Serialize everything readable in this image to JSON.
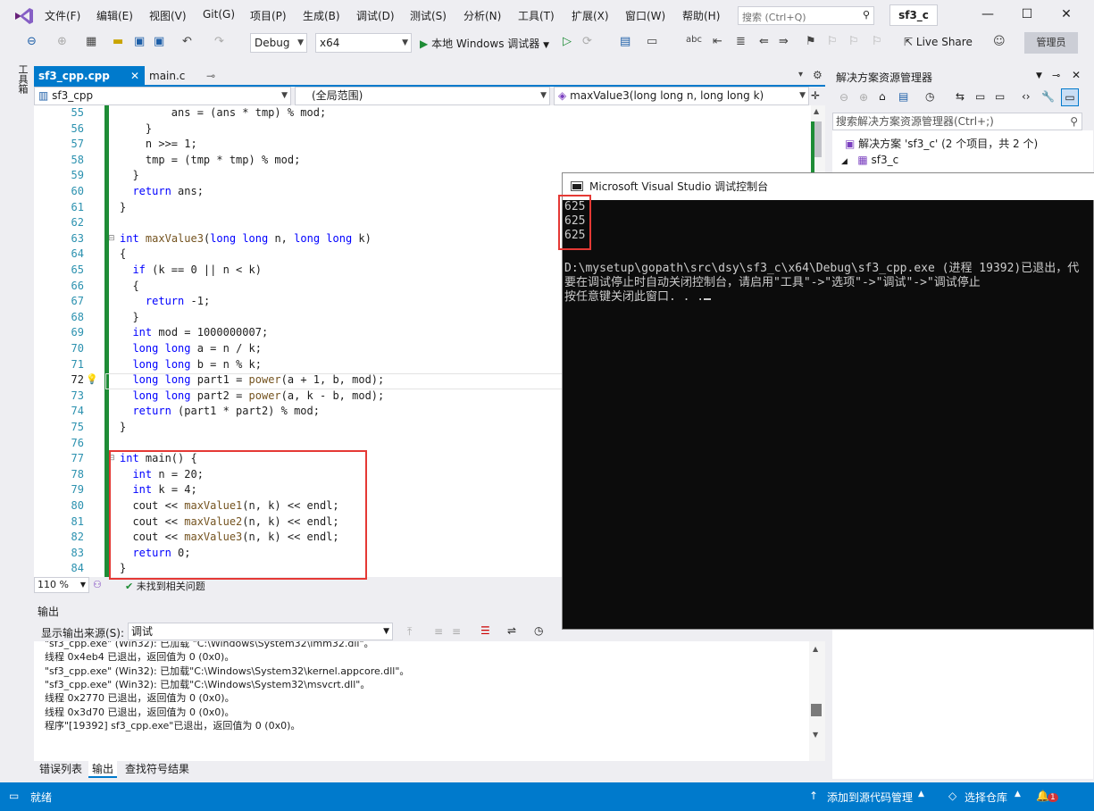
{
  "menubar": {
    "items": [
      "文件(F)",
      "编辑(E)",
      "视图(V)",
      "Git(G)",
      "项目(P)",
      "生成(B)",
      "调试(D)",
      "测试(S)",
      "分析(N)",
      "工具(T)",
      "扩展(X)",
      "窗口(W)",
      "帮助(H)"
    ],
    "search_placeholder": "搜索 (Ctrl+Q)",
    "project_name": "sf3_c"
  },
  "toolbar": {
    "config": "Debug",
    "platform": "x64",
    "debug_target": "本地 Windows 调试器",
    "live_share": "Live Share",
    "admin_label": "管理员"
  },
  "left_strip": {
    "label": "工具箱"
  },
  "editor": {
    "tabs": [
      {
        "label": "sf3_cpp.cpp",
        "active": true
      },
      {
        "label": "main.c",
        "active": false
      }
    ],
    "nav": {
      "project": "sf3_cpp",
      "scope": "(全局范围)",
      "member": "maxValue3(long long n, long long k)"
    },
    "zoom": "110 %",
    "issues": "未找到相关问题",
    "current_line": "72",
    "lines": [
      {
        "n": "55",
        "t": "        ans = (ans * tmp) % mod;"
      },
      {
        "n": "56",
        "t": "    }"
      },
      {
        "n": "57",
        "t": "    n >>= 1;"
      },
      {
        "n": "58",
        "t": "    tmp = (tmp * tmp) % mod;"
      },
      {
        "n": "59",
        "t": "  }"
      },
      {
        "n": "60",
        "t": "  return ans;"
      },
      {
        "n": "61",
        "t": "}"
      },
      {
        "n": "62",
        "t": ""
      },
      {
        "n": "63",
        "t": "int maxValue3(long long n, long long k)"
      },
      {
        "n": "64",
        "t": "{"
      },
      {
        "n": "65",
        "t": "  if (k == 0 || n < k)"
      },
      {
        "n": "66",
        "t": "  {"
      },
      {
        "n": "67",
        "t": "    return -1;"
      },
      {
        "n": "68",
        "t": "  }"
      },
      {
        "n": "69",
        "t": "  int mod = 1000000007;"
      },
      {
        "n": "70",
        "t": "  long long a = n / k;"
      },
      {
        "n": "71",
        "t": "  long long b = n % k;"
      },
      {
        "n": "72",
        "t": "  long long part1 = power(a + 1, b, mod);"
      },
      {
        "n": "73",
        "t": "  long long part2 = power(a, k - b, mod);"
      },
      {
        "n": "74",
        "t": "  return (part1 * part2) % mod;"
      },
      {
        "n": "75",
        "t": "}"
      },
      {
        "n": "76",
        "t": ""
      },
      {
        "n": "77",
        "t": "int main() {"
      },
      {
        "n": "78",
        "t": "  int n = 20;"
      },
      {
        "n": "79",
        "t": "  int k = 4;"
      },
      {
        "n": "80",
        "t": "  cout << maxValue1(n, k) << endl;"
      },
      {
        "n": "81",
        "t": "  cout << maxValue2(n, k) << endl;"
      },
      {
        "n": "82",
        "t": "  cout << maxValue3(n, k) << endl;"
      },
      {
        "n": "83",
        "t": "  return 0;"
      },
      {
        "n": "84",
        "t": "}"
      }
    ]
  },
  "output": {
    "title": "输出",
    "source_label": "显示输出来源(S):",
    "source_value": "调试",
    "lines": [
      "\"sf3_cpp.exe\" (Win32): 已加载 \"C:\\Windows\\System32\\imm32.dll\"。",
      "线程 0x4eb4 已退出，返回值为 0 (0x0)。",
      "\"sf3_cpp.exe\" (Win32): 已加载\"C:\\Windows\\System32\\kernel.appcore.dll\"。",
      "\"sf3_cpp.exe\" (Win32): 已加载\"C:\\Windows\\System32\\msvcrt.dll\"。",
      "线程 0x2770 已退出，返回值为 0 (0x0)。",
      "线程 0x3d70 已退出，返回值为 0 (0x0)。",
      "程序\"[19392] sf3_cpp.exe\"已退出，返回值为 0 (0x0)。"
    ],
    "bottom_tabs": [
      "错误列表",
      "输出",
      "查找符号结果"
    ]
  },
  "solution_explorer": {
    "title": "解决方案资源管理器",
    "search_placeholder": "搜索解决方案资源管理器(Ctrl+;)",
    "solution": "解决方案 'sf3_c' (2 个项目，共 2 个)",
    "project": "sf3_c"
  },
  "console": {
    "title": "Microsoft Visual Studio 调试控制台",
    "outputs": [
      "625",
      "625",
      "625"
    ],
    "exit_line": "D:\\mysetup\\gopath\\src\\dsy\\sf3_c\\x64\\Debug\\sf3_cpp.exe (进程 19392)已退出，代",
    "hint_line": "要在调试停止时自动关闭控制台，请启用\"工具\"->\"选项\"->\"调试\"->\"调试停止",
    "press_line": "按任意键关闭此窗口. . ."
  },
  "statusbar": {
    "ready": "就绪",
    "add_source": "添加到源代码管理",
    "select_repo": "选择仓库",
    "notifications": "1"
  }
}
